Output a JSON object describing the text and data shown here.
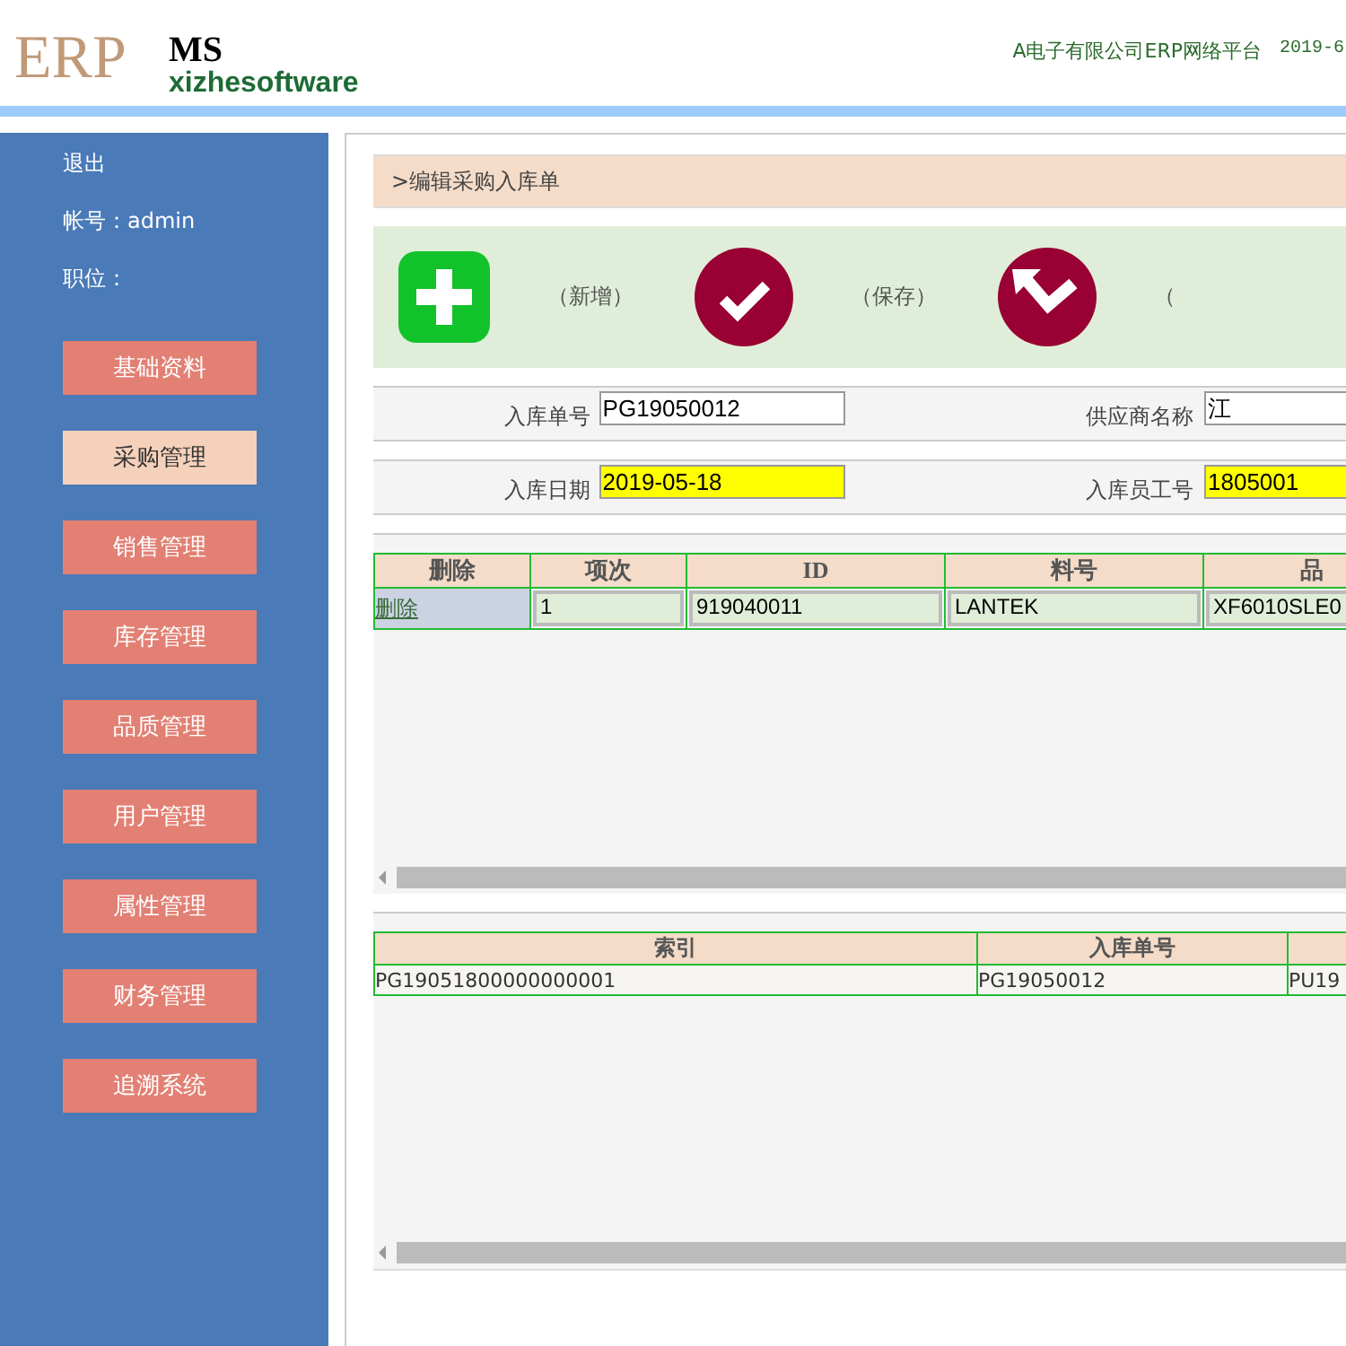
{
  "header": {
    "logo": "ERP",
    "brand_top": "MS",
    "brand_bottom": "xizhesoftware",
    "company": "A电子有限公司ERP网络平台",
    "date": "2019-6"
  },
  "sidebar": {
    "logout": "退出",
    "account": "帐号：admin",
    "position": "职位：",
    "menu": [
      {
        "label": "基础资料",
        "selected": false
      },
      {
        "label": "采购管理",
        "selected": true
      },
      {
        "label": "销售管理",
        "selected": false
      },
      {
        "label": "库存管理",
        "selected": false
      },
      {
        "label": "品质管理",
        "selected": false
      },
      {
        "label": "用户管理",
        "selected": false
      },
      {
        "label": "属性管理",
        "selected": false
      },
      {
        "label": "财务管理",
        "selected": false
      },
      {
        "label": "追溯系统",
        "selected": false
      }
    ]
  },
  "breadcrumb": ">编辑采购入库单",
  "toolbar": [
    {
      "kind": "add",
      "label": "（新增）"
    },
    {
      "kind": "save",
      "label": "（保存）"
    },
    {
      "kind": "return",
      "label": "（"
    }
  ],
  "form": [
    [
      {
        "label": "入库单号",
        "value": "PG19050012",
        "highlighted": false
      },
      {
        "label": "供应商名称",
        "value": "江",
        "highlighted": false
      }
    ],
    [
      {
        "label": "入库日期",
        "value": "2019-05-18",
        "highlighted": true
      },
      {
        "label": "入库员工号",
        "value": "1805001",
        "highlighted": true
      }
    ]
  ],
  "detail_table": {
    "columns": [
      "删除",
      "项次",
      "ID",
      "料号",
      "品"
    ],
    "rows": [
      {
        "cells": [
          "删除",
          "1",
          "919040011",
          "LANTEK",
          "XF6010SLE0"
        ]
      }
    ]
  },
  "index_table": {
    "columns": [
      "索引",
      "入库单号"
    ],
    "rows": [
      {
        "cells": [
          "PG19051800000000001",
          "PG19050012",
          "PU19"
        ]
      }
    ]
  }
}
